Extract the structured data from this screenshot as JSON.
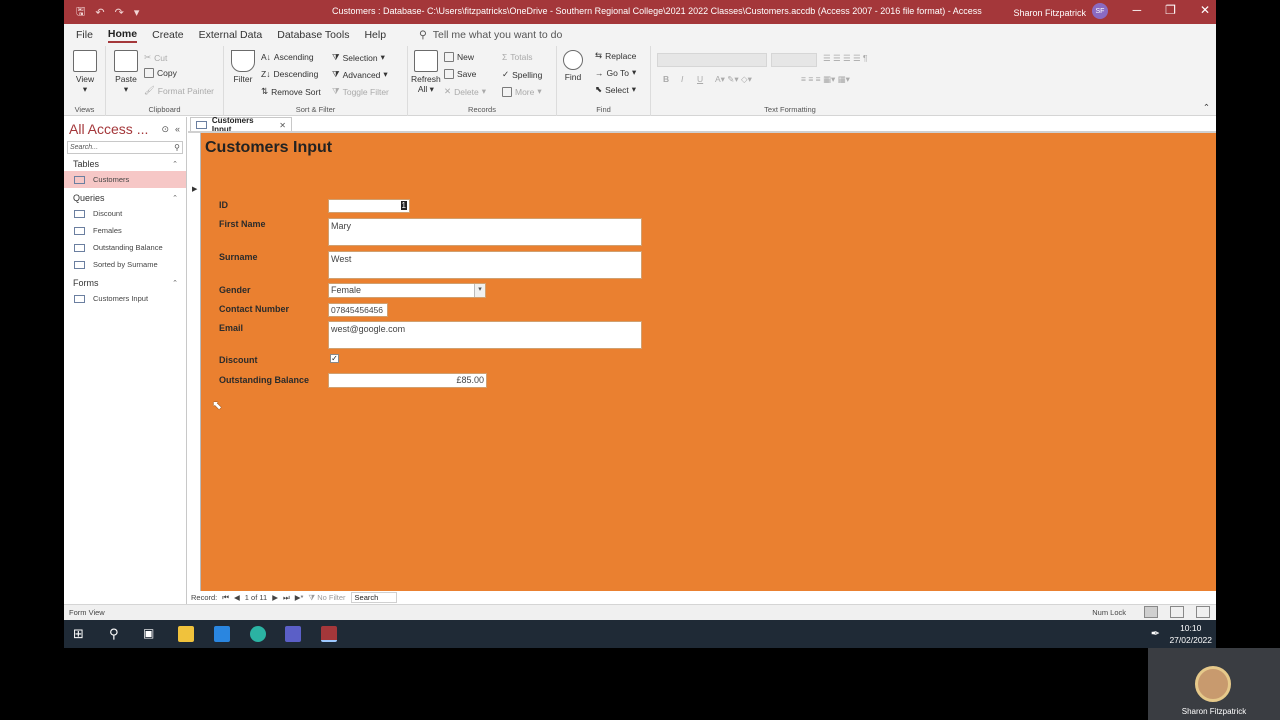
{
  "window": {
    "title": "Customers : Database- C:\\Users\\fitzpatricks\\OneDrive - Southern Regional College\\2021 2022 Classes\\Customers.accdb (Access 2007 - 2016 file format)  -  Access",
    "user": "Sharon Fitzpatrick",
    "user_initials": "SF"
  },
  "menu": {
    "tabs": [
      "File",
      "Home",
      "Create",
      "External Data",
      "Database Tools",
      "Help"
    ],
    "tell_me": "Tell me what you want to do"
  },
  "ribbon": {
    "views": {
      "view": "View",
      "label": "Views"
    },
    "clipboard": {
      "paste": "Paste",
      "cut": "Cut",
      "copy": "Copy",
      "format_painter": "Format Painter",
      "label": "Clipboard"
    },
    "sort_filter": {
      "filter": "Filter",
      "ascending": "Ascending",
      "descending": "Descending",
      "remove_sort": "Remove Sort",
      "selection": "Selection",
      "advanced": "Advanced",
      "toggle_filter": "Toggle Filter",
      "label": "Sort & Filter"
    },
    "records": {
      "refresh": "Refresh",
      "refresh_all": "All",
      "new": "New",
      "save": "Save",
      "delete": "Delete",
      "totals": "Totals",
      "spelling": "Spelling",
      "more": "More",
      "label": "Records"
    },
    "find": {
      "find": "Find",
      "replace": "Replace",
      "goto": "Go To",
      "select": "Select",
      "label": "Find"
    },
    "text_formatting": {
      "bold": "B",
      "italic": "I",
      "underline": "U",
      "label": "Text Formatting"
    }
  },
  "nav": {
    "title": "All Access ...",
    "search_placeholder": "Search...",
    "categories": [
      {
        "name": "Tables",
        "items": [
          "Customers"
        ]
      },
      {
        "name": "Queries",
        "items": [
          "Discount",
          "Females",
          "Outstanding Balance",
          "Sorted by Surname"
        ]
      },
      {
        "name": "Forms",
        "items": [
          "Customers Input"
        ]
      }
    ]
  },
  "document": {
    "tab_label": "Customers Input",
    "form_title": "Customers Input",
    "fields": {
      "id": {
        "label": "ID",
        "value": "1"
      },
      "first_name": {
        "label": "First Name",
        "value": "Mary"
      },
      "surname": {
        "label": "Surname",
        "value": "West"
      },
      "gender": {
        "label": "Gender",
        "value": "Female"
      },
      "contact": {
        "label": "Contact Number",
        "value": "07845456456"
      },
      "email": {
        "label": "Email",
        "value": "west@google.com"
      },
      "discount": {
        "label": "Discount",
        "checked": true
      },
      "balance": {
        "label": "Outstanding Balance",
        "value": "£85.00"
      }
    },
    "form_color": "#ea8030"
  },
  "record_nav": {
    "label": "Record:",
    "position": "1 of 11",
    "filter": "No Filter",
    "search": "Search"
  },
  "statusbar": {
    "left": "Form View",
    "right": "Num Lock"
  },
  "taskbar": {
    "time": "10:10",
    "date": "27/02/2022"
  },
  "webcam": {
    "name": "Sharon Fitzpatrick"
  }
}
